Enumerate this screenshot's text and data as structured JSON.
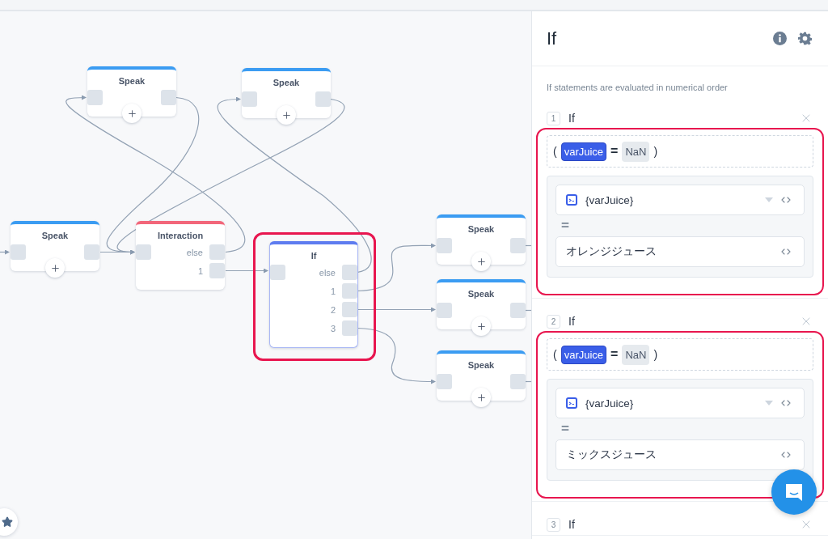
{
  "canvas": {
    "nodes": [
      {
        "kind": "speak",
        "title": "Speak",
        "highlighted": false
      },
      {
        "kind": "speak",
        "title": "Speak",
        "highlighted": false
      },
      {
        "kind": "speak",
        "title": "Speak",
        "highlighted": false
      },
      {
        "kind": "interaction",
        "title": "Interaction",
        "ports": [
          "else",
          "1"
        ],
        "highlighted": false
      },
      {
        "kind": "if",
        "title": "If",
        "ports": [
          "else",
          "1",
          "2",
          "3"
        ],
        "highlighted": true
      },
      {
        "kind": "speak",
        "title": "Speak",
        "highlighted": false
      },
      {
        "kind": "speak",
        "title": "Speak",
        "highlighted": false
      },
      {
        "kind": "speak",
        "title": "Speak",
        "highlighted": false
      }
    ]
  },
  "panel": {
    "title": "If",
    "note": "If statements are evaluated in numerical order",
    "conditions": [
      {
        "number": "1",
        "label": "If",
        "highlighted": true,
        "expression": {
          "open": "(",
          "variable": "varJuice",
          "operator": "=",
          "value": "NaN",
          "close": ")"
        },
        "fields": [
          {
            "kind": "variable",
            "value": "{varJuice}"
          },
          {
            "kind": "operator",
            "value": "="
          },
          {
            "kind": "text",
            "value": "オレンジジュース"
          }
        ]
      },
      {
        "number": "2",
        "label": "If",
        "highlighted": true,
        "expression": {
          "open": "(",
          "variable": "varJuice",
          "operator": "=",
          "value": "NaN",
          "close": ")"
        },
        "fields": [
          {
            "kind": "variable",
            "value": "{varJuice}"
          },
          {
            "kind": "operator",
            "value": "="
          },
          {
            "kind": "text",
            "value": "ミックスジュース"
          }
        ]
      },
      {
        "number": "3",
        "label": "If"
      }
    ]
  }
}
